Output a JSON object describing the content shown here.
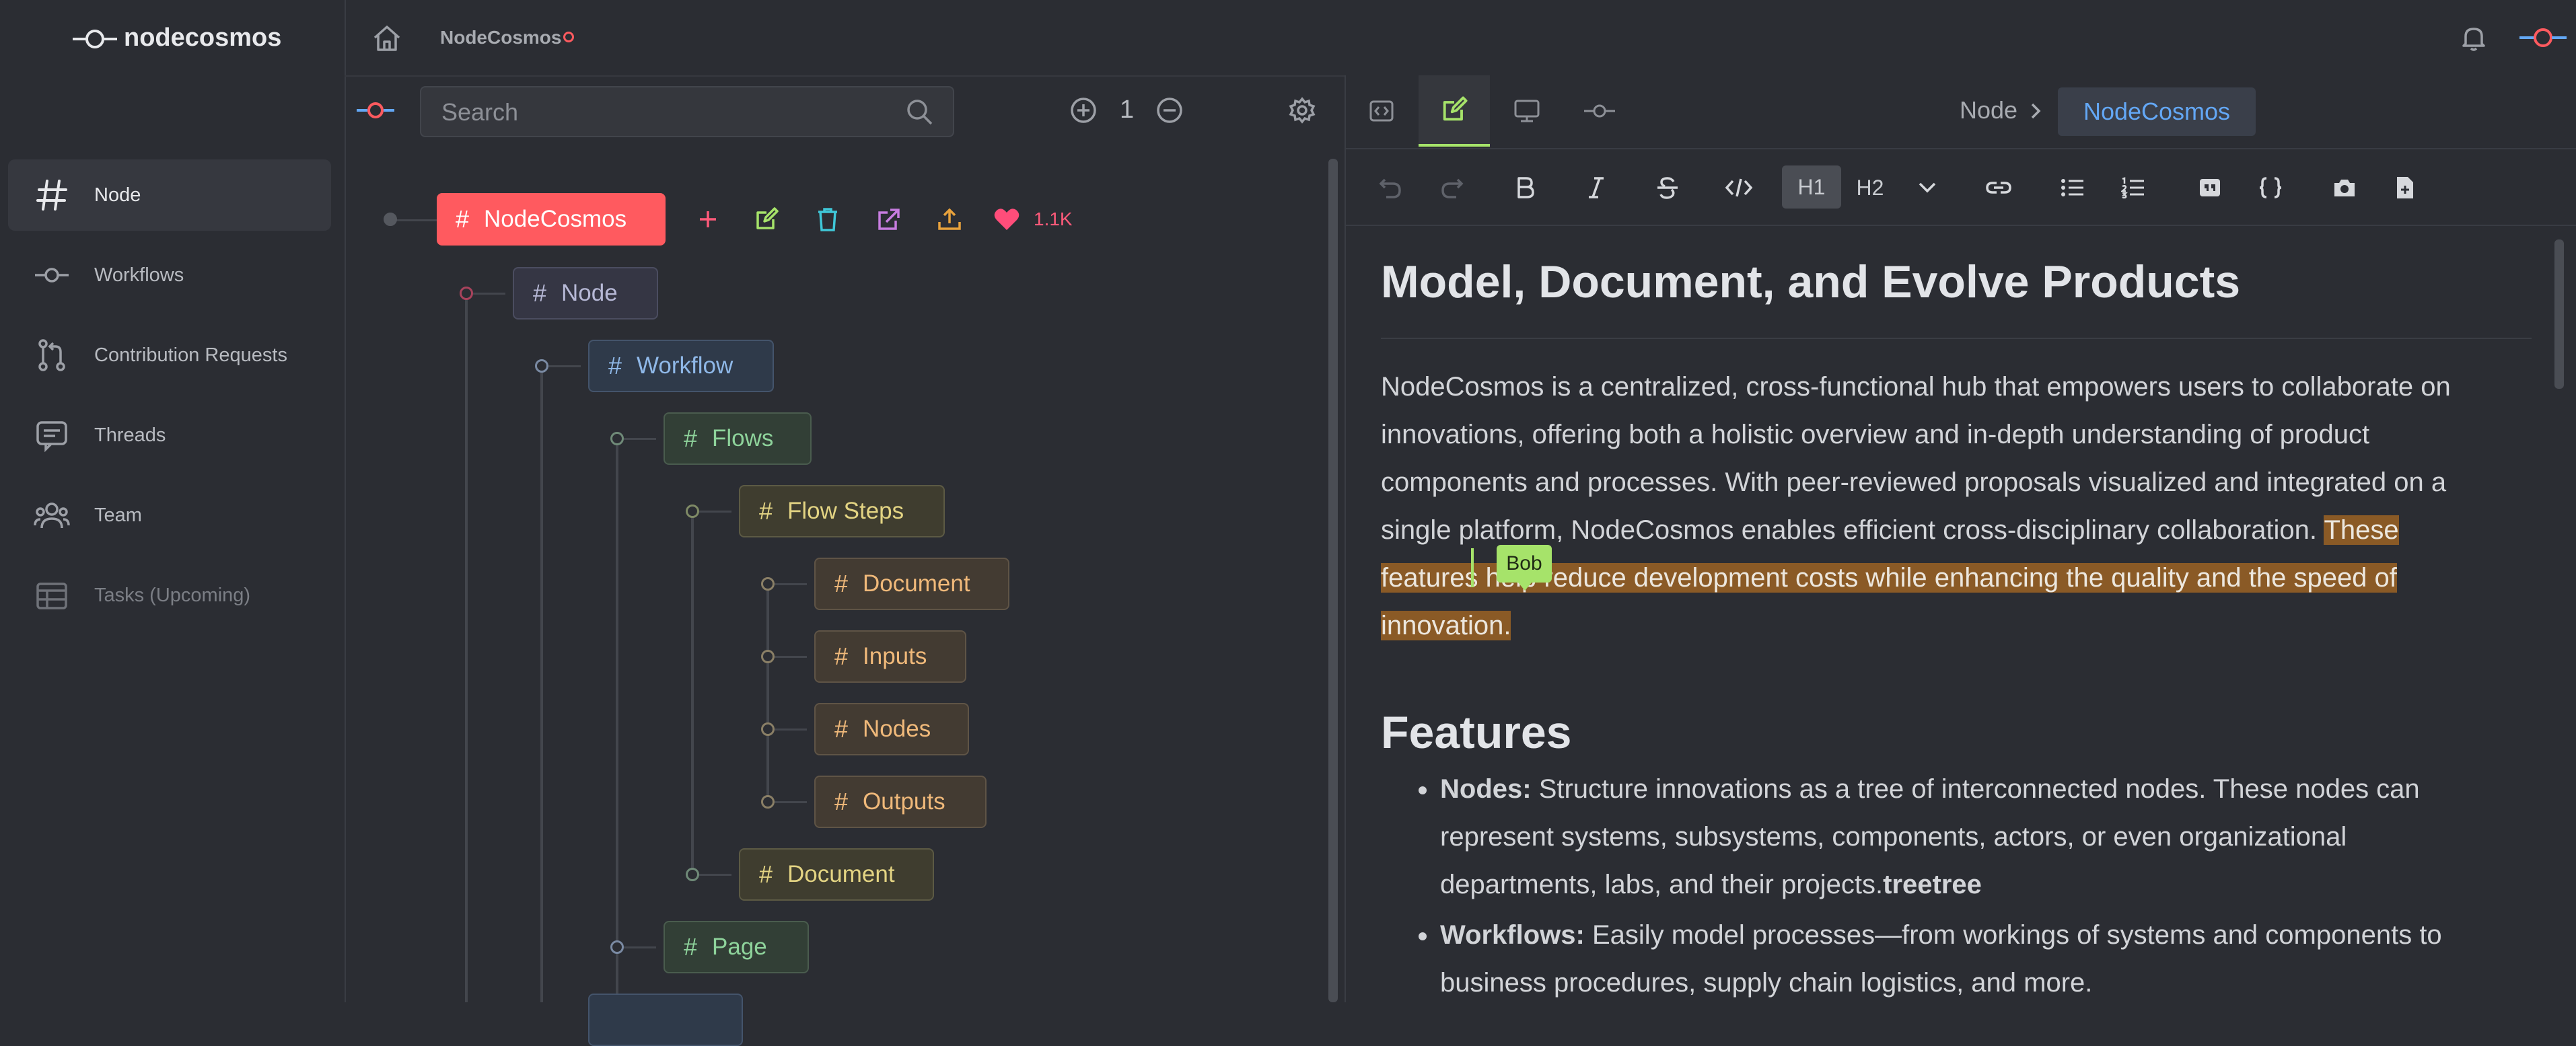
{
  "app": {
    "brand": "nodecosmos",
    "breadcrumb_title": "NodeCosmos"
  },
  "sidebar": {
    "items": [
      {
        "label": "Node",
        "icon": "hash-icon"
      },
      {
        "label": "Workflows",
        "icon": "workflow-icon"
      },
      {
        "label": "Contribution Requests",
        "icon": "pull-request-icon"
      },
      {
        "label": "Threads",
        "icon": "threads-icon"
      },
      {
        "label": "Team",
        "icon": "team-icon"
      },
      {
        "label": "Tasks (Upcoming)",
        "icon": "table-icon"
      }
    ]
  },
  "tree_toolbar": {
    "search_placeholder": "Search",
    "depth_value": "1"
  },
  "tree": {
    "root": {
      "label": "NodeCosmos",
      "likes": "1.1K"
    },
    "nodes": [
      {
        "label": "Node"
      },
      {
        "label": "Workflow"
      },
      {
        "label": "Flows"
      },
      {
        "label": "Flow Steps"
      },
      {
        "label": "Document"
      },
      {
        "label": "Inputs"
      },
      {
        "label": "Nodes"
      },
      {
        "label": "Outputs"
      },
      {
        "label": "Document"
      },
      {
        "label": "Page"
      }
    ]
  },
  "editor": {
    "breadcrumb": {
      "parent": "Node",
      "current": "NodeCosmos"
    },
    "toolbar": {
      "h1": "H1",
      "h2": "H2"
    },
    "heading": "Model, Document, and Evolve Products",
    "intro_plain": "NodeCosmos is a centralized, cross-functional hub that empowers users to collaborate on innovations, offering both a holistic overview and in-depth understanding of product components and processes. With peer-reviewed proposals visualized and integrated on a single platform, NodeCosmos enables efficient cross-disciplinary collaboration. ",
    "intro_highlight": "These features help reduce development costs while enhancing the quality and the speed of innovation.",
    "cursor_user": "Bob",
    "features_heading": "Features",
    "features": [
      {
        "title": "Nodes:",
        "text": " Structure innovations as a tree of interconnected nodes. These nodes can represent systems, subsystems, components, actors, or even organizational departments, labs, and their projects.",
        "suffix": "treetree"
      },
      {
        "title": "Workflows:",
        "text": " Easily model processes—from workings of systems and components to business procedures, supply chain logistics, and more.",
        "suffix": ""
      }
    ]
  },
  "colors": {
    "background": "#2b2d33",
    "accent_red": "#ff5a5f",
    "accent_green": "#a6e36a",
    "accent_blue": "#63a7f5"
  }
}
